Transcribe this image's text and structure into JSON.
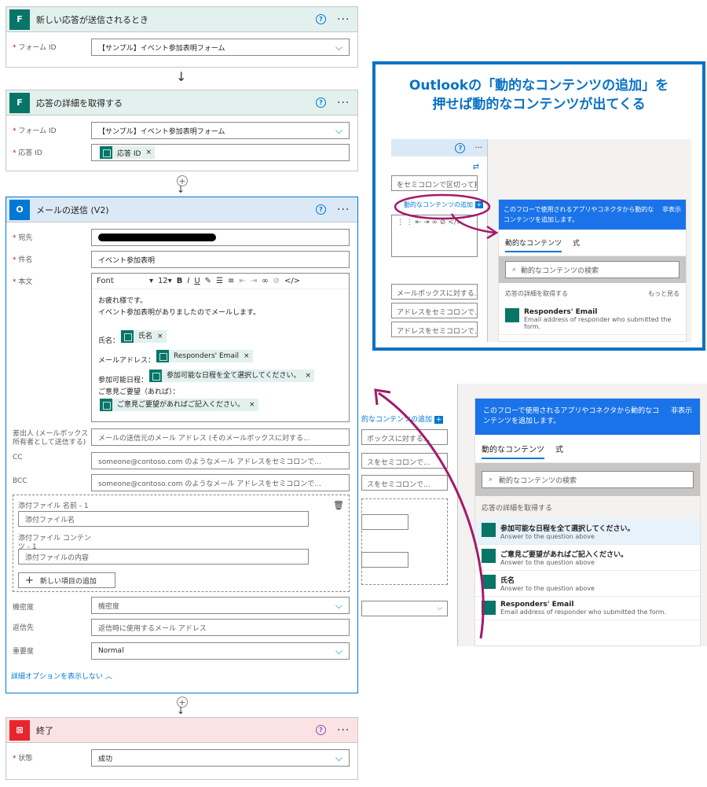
{
  "flow": {
    "trigger": {
      "title": "新しい応答が送信されるとき",
      "form_id_label": "フォーム ID",
      "form_id_value": "【サンプル】イベント参加表明フォーム"
    },
    "get_details": {
      "title": "応答の詳細を取得する",
      "form_id_label": "フォーム ID",
      "form_id_value": "【サンプル】イベント参加表明フォーム",
      "response_id_label": "応答 ID",
      "response_id_token": "応答 ID"
    },
    "send_mail": {
      "title": "メールの送信 (V2)",
      "to_label": "宛先",
      "subject_label": "件名",
      "subject_value": "イベント参加表明",
      "body_label": "本文",
      "font_value": "Font",
      "font_size": "12",
      "body_line1": "お疲れ様です。",
      "body_line2": "イベント参加表明がありましたのでメールします。",
      "name_label": "氏名：",
      "name_token": "氏名",
      "mail_label": "メールアドレス：",
      "mail_token": "Responders' Email",
      "date_label": "参加可能日程：",
      "date_token": "参加可能な日程を全て選択してください。",
      "request_label": "ご意見ご要望（あれば）：",
      "request_token": "ご意見ご要望があればご記入ください。",
      "from_label": "差出人 (メールボックス所有者として送信する)",
      "from_placeholder": "メールの送信元のメール アドレス (そのメールボックスに対する...",
      "cc_label": "CC",
      "cc_placeholder": "someone@contoso.com のようなメール アドレスをセミコロンで...",
      "bcc_label": "BCC",
      "bcc_placeholder": "someone@contoso.com のようなメール アドレスをセミコロンで...",
      "attach_name_label": "添付ファイル 名前 - 1",
      "attach_name_placeholder": "添付ファイル名",
      "attach_content_label": "添付ファイル コンテンツ - 1",
      "attach_content_placeholder": "添付ファイルの内容",
      "add_item": "新しい項目の追加",
      "sensitivity_label": "機密度",
      "sensitivity_placeholder": "機密度",
      "reply_to_label": "返信先",
      "reply_to_placeholder": "返信時に使用するメール アドレス",
      "importance_label": "重要度",
      "importance_value": "Normal",
      "hide_advanced": "詳細オプションを表示しない"
    },
    "terminate": {
      "title": "終了",
      "status_label": "状態",
      "status_value": "成功"
    }
  },
  "callout": {
    "title_line1": "Outlookの「動的なコンテンツの追加」を",
    "title_line2": "押せば動的なコンテンツが出てくる",
    "add_dynamic_link": "動的なコンテンツの追加",
    "ghost_1": "をセミコロンで区切って指定",
    "ghost_2": "メールボックスに対する...",
    "ghost_3": "アドレスをセミコロンで...",
    "ghost_4": "アドレスをセミコロンで..."
  },
  "dynamic_panel": {
    "header": "このフローで使用されるアプリやコネクタから動的なコンテンツを追加します。",
    "hide": "非表示",
    "tab_dynamic": "動的なコンテンツ",
    "tab_expression": "式",
    "search_placeholder": "動的なコンテンツの検索",
    "section": "応答の詳細を取得する",
    "see_more": "もっと見る",
    "items": [
      {
        "name": "参加可能な日程を全て選択してください。",
        "desc": "Answer to the question above"
      },
      {
        "name": "ご意見ご要望があればご記入ください。",
        "desc": "Answer to the question above"
      },
      {
        "name": "氏名",
        "desc": "Answer to the question above"
      },
      {
        "name": "Responders' Email",
        "desc": "Email address of responder who submitted the form."
      }
    ]
  },
  "lower_ghost": {
    "add_dynamic_link": "的なコンテンツの追加",
    "ghost_1": "ボックスに対する...",
    "ghost_2": "スをセミコロンで...",
    "ghost_3": "スをセミコロンで..."
  },
  "colors": {
    "forms_green": "#077568",
    "outlook_blue": "#0078d4",
    "terminate_red": "#e8262e",
    "callout_blue": "#0a72c6",
    "annotation_magenta": "#a31b6a"
  }
}
